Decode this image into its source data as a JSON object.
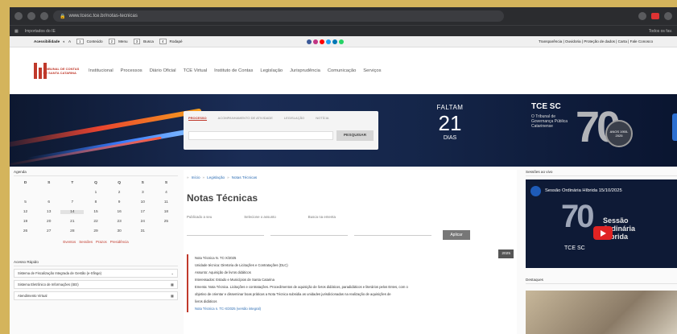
{
  "browser": {
    "url": "www.tcesc.tce.br/notas-tecnicas",
    "bookmarks_left": "Importados do IE",
    "bookmarks_right": "Todos os fav."
  },
  "accessibility": {
    "label": "Acessibilidade",
    "items": [
      "Conteúdo",
      "Menu",
      "Busca",
      "Rodapé"
    ],
    "keys": [
      "1",
      "2",
      "3",
      "4"
    ],
    "right": "Transparência | Ouvidoria | Proteção de dados | Carta | Fale Conosco",
    "social_colors": [
      "#3b5998",
      "#c13584",
      "#ff0000",
      "#1da1f2",
      "#0077b5",
      "#25d366"
    ]
  },
  "header": {
    "logo_text": "TRIBUNAL DE CONTAS DE SANTA CATARINA",
    "nav": [
      "Institucional",
      "Processos",
      "Diário Oficial",
      "TCE Virtual",
      "Instituto de Contas",
      "Legislação",
      "Jurisprudência",
      "Comunicação",
      "Serviços"
    ]
  },
  "hero": {
    "search_tabs": [
      "PROCESSO",
      "ACOMPANHAMENTO DE ATIVIDADE",
      "LEGISLAÇÃO",
      "NOTÍCIA"
    ],
    "search_button": "PESQUISAR",
    "countdown_top": "FALTAM",
    "countdown_number": "21",
    "countdown_bottom": "DIAS",
    "anniv_logo": "TCE SC",
    "anniv_text": "O Tribunal de Governança Pública Catarinense",
    "anniv_number": "70",
    "seal_text": "ANOS 1955-2025"
  },
  "agenda": {
    "title": "Agenda",
    "weekdays": [
      "D",
      "S",
      "T",
      "Q",
      "Q",
      "S",
      "S"
    ],
    "days": [
      "",
      "",
      "",
      "1",
      "2",
      "3",
      "4",
      "5",
      "6",
      "7",
      "8",
      "9",
      "10",
      "11",
      "12",
      "13",
      "14",
      "15",
      "16",
      "17",
      "18",
      "19",
      "20",
      "21",
      "22",
      "23",
      "24",
      "25",
      "26",
      "27",
      "28",
      "29",
      "30",
      "31",
      ""
    ],
    "legend": [
      "Eventos",
      "Sessões",
      "Prazos",
      "Presidência"
    ]
  },
  "quick_access": {
    "title": "Acesso Rápido",
    "items": [
      "Sistema de Fiscalização Integrada de Gestão (e-Sfinge)",
      "Sistema Eletrônico de Informações (SEI)",
      "Atendimento Virtual"
    ]
  },
  "main": {
    "breadcrumb": [
      "Início",
      "Legislação",
      "Notas Técnicas"
    ],
    "title": "Notas Técnicas",
    "filters": [
      "Publicado a seu",
      "Selecione o assunto",
      "Busca na ementa"
    ],
    "apply_label": "Aplicar",
    "result": {
      "year": "2025",
      "lines": [
        "Nota Técnica N. TC-X/2025",
        "Unidade técnica: Diretoria de Licitações e Contratações (DLC)",
        "Assunto: Aquisição de livros didáticos",
        "Interessados: Estado e Municípios de Santa Catarina",
        "Ementa: Nota Técnica. Licitações e contratações. Procedimentos de aquisição de livros didáticos, paradidáticos e literários pelos Entes, com o",
        "objetivo de orientar e disseminar boas práticas a Nota Técnica subsidia as unidades jurisdicionadas na realização de aquisições de",
        "livros didáticos"
      ],
      "link": "Nota Técnica n. TC-X/2025 (versão integral)"
    }
  },
  "sidebar": {
    "sessions_title": "Sessões ao vivo",
    "video_title": "Sessão Ordinária Híbrida 15/10/2025",
    "video_big": "70",
    "video_logo": "TCE SC",
    "video_overlay": "Sessão Ordinária Híbrida",
    "photo_title": "Destaques"
  }
}
